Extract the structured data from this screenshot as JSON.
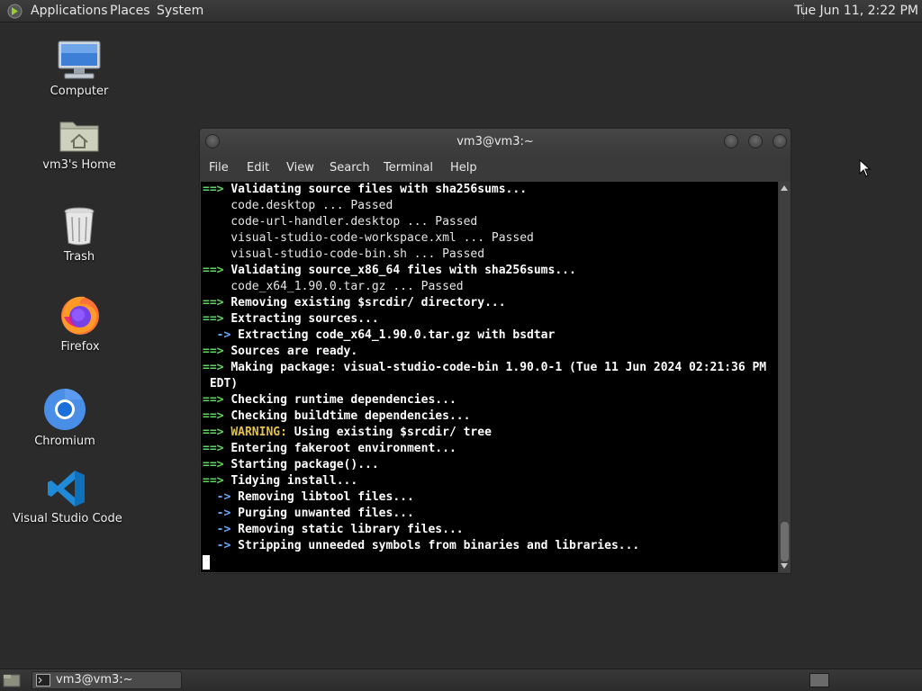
{
  "top_panel": {
    "menus": [
      "Applications",
      "Places",
      "System"
    ],
    "clock": "Tue Jun 11,  2:22 PM"
  },
  "desktop": {
    "icons": [
      {
        "label": "Computer",
        "icon": "computer-icon"
      },
      {
        "label": "vm3's Home",
        "icon": "home-folder-icon"
      },
      {
        "label": "Trash",
        "icon": "trash-icon"
      },
      {
        "label": "Firefox",
        "icon": "firefox-icon"
      },
      {
        "label": "Chromium",
        "icon": "chromium-icon"
      },
      {
        "label": "Visual Studio Code",
        "icon": "vscode-icon"
      }
    ]
  },
  "terminal": {
    "title": "vm3@vm3:~",
    "menu": [
      "File",
      "Edit",
      "View",
      "Search",
      "Terminal",
      "Help"
    ],
    "lines": [
      {
        "prefix": "==>",
        "kind": "g",
        "text": "Validating source files with sha256sums...",
        "bold": true
      },
      {
        "prefix": "",
        "kind": "",
        "text": "    code.desktop ... Passed",
        "bold": false
      },
      {
        "prefix": "",
        "kind": "",
        "text": "    code-url-handler.desktop ... Passed",
        "bold": false
      },
      {
        "prefix": "",
        "kind": "",
        "text": "    visual-studio-code-workspace.xml ... Passed",
        "bold": false
      },
      {
        "prefix": "",
        "kind": "",
        "text": "    visual-studio-code-bin.sh ... Passed",
        "bold": false
      },
      {
        "prefix": "==>",
        "kind": "g",
        "text": "Validating source_x86_64 files with sha256sums...",
        "bold": true
      },
      {
        "prefix": "",
        "kind": "",
        "text": "    code_x64_1.90.0.tar.gz ... Passed",
        "bold": false
      },
      {
        "prefix": "==>",
        "kind": "g",
        "text": "Removing existing $srcdir/ directory...",
        "bold": true
      },
      {
        "prefix": "==>",
        "kind": "g",
        "text": "Extracting sources...",
        "bold": true
      },
      {
        "prefix": "  ->",
        "kind": "b",
        "text": "Extracting code_x64_1.90.0.tar.gz with bsdtar",
        "bold": true
      },
      {
        "prefix": "==>",
        "kind": "g",
        "text": "Sources are ready.",
        "bold": true
      },
      {
        "prefix": "==>",
        "kind": "g",
        "text": "Making package: visual-studio-code-bin 1.90.0-1 (Tue 11 Jun 2024 02:21:36 PM",
        "bold": true
      },
      {
        "prefix": "",
        "kind": "",
        "text": " EDT)",
        "bold": true
      },
      {
        "prefix": "==>",
        "kind": "g",
        "text": "Checking runtime dependencies...",
        "bold": true
      },
      {
        "prefix": "==>",
        "kind": "g",
        "text": "Checking buildtime dependencies...",
        "bold": true
      },
      {
        "prefix": "==>",
        "kind": "g",
        "warn": "WARNING:",
        "text": "Using existing $srcdir/ tree",
        "bold": true
      },
      {
        "prefix": "==>",
        "kind": "g",
        "text": "Entering fakeroot environment...",
        "bold": true
      },
      {
        "prefix": "==>",
        "kind": "g",
        "text": "Starting package()...",
        "bold": true
      },
      {
        "prefix": "==>",
        "kind": "g",
        "text": "Tidying install...",
        "bold": true
      },
      {
        "prefix": "  ->",
        "kind": "b",
        "text": "Removing libtool files...",
        "bold": true
      },
      {
        "prefix": "  ->",
        "kind": "b",
        "text": "Purging unwanted files...",
        "bold": true
      },
      {
        "prefix": "  ->",
        "kind": "b",
        "text": "Removing static library files...",
        "bold": true
      },
      {
        "prefix": "  ->",
        "kind": "b",
        "text": "Stripping unneeded symbols from binaries and libraries...",
        "bold": true
      }
    ]
  },
  "taskbar": {
    "task_label": "vm3@vm3:~"
  },
  "colors": {
    "arrow_green": "#5fd75f",
    "arrow_blue": "#6aa8ff",
    "warning_yellow": "#e6c24a",
    "desktop_bg": "#2b2b2b"
  }
}
